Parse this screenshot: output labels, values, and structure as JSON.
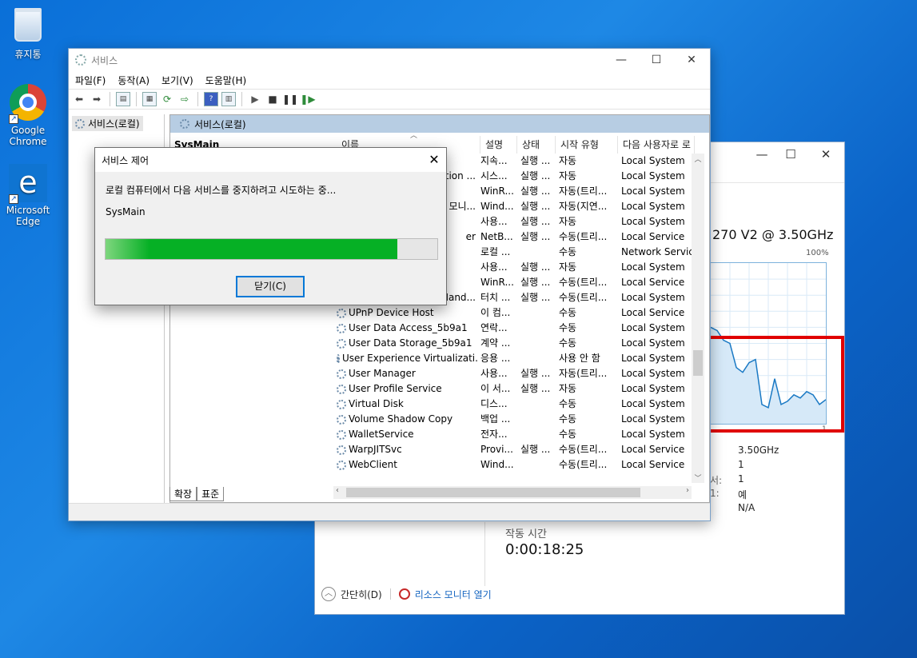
{
  "desktop": {
    "icons": [
      {
        "label": "휴지통",
        "icon": "recycle-bin-icon"
      },
      {
        "label": "Google Chrome",
        "icon": "chrome-icon"
      },
      {
        "label": "Microsoft Edge",
        "icon": "edge-icon"
      }
    ]
  },
  "taskmgr": {
    "cpu_name": "270 V2 @ 3.50GHz",
    "max_pct": "100%",
    "axis_min": "1",
    "stats": [
      "3.50GHz",
      "1",
      "1",
      "예",
      "N/A"
    ],
    "stat_labels": [
      "서:",
      "1:"
    ],
    "uptime_label": "작동 시간",
    "uptime": "0:00:18:25",
    "fewer_details": "간단히(D)",
    "resource_monitor": "리소스 모니터 열기",
    "cpu_history": [
      0.6,
      0.58,
      0.52,
      0.5,
      0.35,
      0.32,
      0.38,
      0.4,
      0.12,
      0.1,
      0.28,
      0.12,
      0.14,
      0.18,
      0.16,
      0.2,
      0.18,
      0.12,
      0.15
    ]
  },
  "services": {
    "title": "서비스",
    "menu": [
      "파일(F)",
      "동작(A)",
      "보기(V)",
      "도움말(H)"
    ],
    "tree_item": "서비스(로컬)",
    "pane_header": "서비스(로컬)",
    "selected_service": "SysMain",
    "columns": [
      "이름",
      "설명",
      "상태",
      "시작 유형",
      "다음 사용자로 로"
    ],
    "rows": [
      {
        "name": "",
        "desc": "지속...",
        "status": "실행 ...",
        "startup": "자동",
        "logon": "Local System"
      },
      {
        "name": "ation ...",
        "desc": "시스...",
        "status": "실행 ...",
        "startup": "자동",
        "logon": "Local System"
      },
      {
        "name": "",
        "desc": "WinR...",
        "status": "실행 ...",
        "startup": "자동(트리...",
        "logon": "Local System"
      },
      {
        "name": "모니...",
        "desc": "Wind...",
        "status": "실행 ...",
        "startup": "자동(지연...",
        "logon": "Local System"
      },
      {
        "name": "",
        "desc": "사용...",
        "status": "실행 ...",
        "startup": "자동",
        "logon": "Local System"
      },
      {
        "name": "er",
        "desc": "NetB...",
        "status": "실행 ...",
        "startup": "수동(트리...",
        "logon": "Local Service"
      },
      {
        "name": "",
        "desc": "로컬 ...",
        "status": "",
        "startup": "수동",
        "logon": "Network Service"
      },
      {
        "name": "",
        "desc": "사용...",
        "status": "실행 ...",
        "startup": "자동",
        "logon": "Local System"
      },
      {
        "name": "",
        "desc": "WinR...",
        "status": "실행 ...",
        "startup": "수동(트리...",
        "logon": "Local Service"
      },
      {
        "name": "Hand...",
        "desc": "터치 ...",
        "status": "실행 ...",
        "startup": "수동(트리...",
        "logon": "Local System"
      },
      {
        "name": "UPnP Device Host",
        "desc": "이 컴...",
        "status": "",
        "startup": "수동",
        "logon": "Local Service"
      },
      {
        "name": "User Data Access_5b9a1",
        "desc": "연락...",
        "status": "",
        "startup": "수동",
        "logon": "Local System"
      },
      {
        "name": "User Data Storage_5b9a1",
        "desc": "계약 ...",
        "status": "",
        "startup": "수동",
        "logon": "Local System"
      },
      {
        "name": "User Experience Virtualizati...",
        "desc": "응용 ...",
        "status": "",
        "startup": "사용 안 함",
        "logon": "Local System"
      },
      {
        "name": "User Manager",
        "desc": "사용...",
        "status": "실행 ...",
        "startup": "자동(트리...",
        "logon": "Local System"
      },
      {
        "name": "User Profile Service",
        "desc": "이 서...",
        "status": "실행 ...",
        "startup": "자동",
        "logon": "Local System"
      },
      {
        "name": "Virtual Disk",
        "desc": "디스...",
        "status": "",
        "startup": "수동",
        "logon": "Local System"
      },
      {
        "name": "Volume Shadow Copy",
        "desc": "백업 ...",
        "status": "",
        "startup": "수동",
        "logon": "Local System"
      },
      {
        "name": "WalletService",
        "desc": "전자...",
        "status": "",
        "startup": "수동",
        "logon": "Local System"
      },
      {
        "name": "WarpJITSvc",
        "desc": "Provi...",
        "status": "실행 ...",
        "startup": "수동(트리...",
        "logon": "Local Service"
      },
      {
        "name": "WebClient",
        "desc": "Wind...",
        "status": "",
        "startup": "수동(트리...",
        "logon": "Local Service"
      }
    ],
    "tabs": [
      "확장",
      "표준"
    ]
  },
  "dialog": {
    "title": "서비스 제어",
    "message": "로컬 컴퓨터에서 다음 서비스를 중지하려고 시도하는 중...",
    "service": "SysMain",
    "progress": 0.88,
    "close_button": "닫기(C)"
  }
}
